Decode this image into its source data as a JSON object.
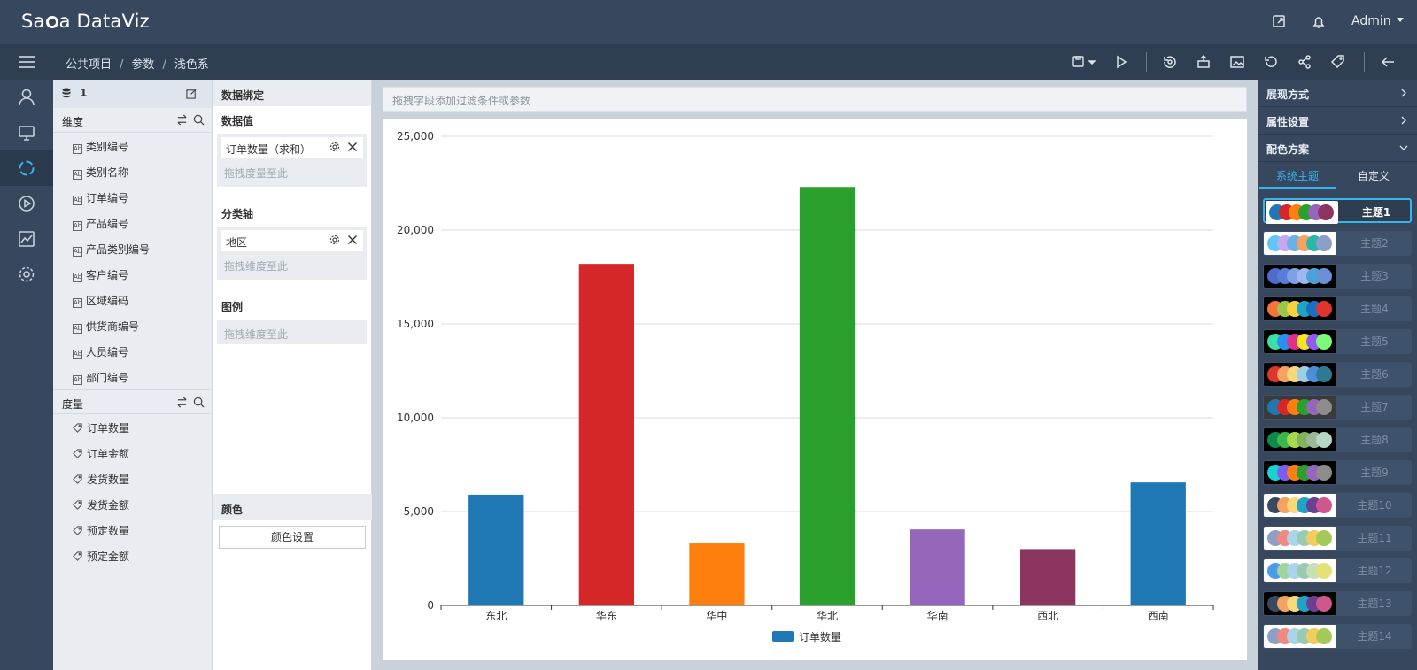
{
  "app": {
    "logo_prefix": "Sa",
    "logo_suffix": "a DataViz",
    "user": "Admin"
  },
  "breadcrumb": [
    "公共项目",
    "参数",
    "浅色系"
  ],
  "fields_panel": {
    "datasource_name": "1",
    "dimensions_title": "维度",
    "dimensions": [
      "类别编号",
      "类别名称",
      "订单编号",
      "产品编号",
      "产品类别编号",
      "客户编号",
      "区域编码",
      "供货商编号",
      "人员编号",
      "部门编号"
    ],
    "measures_title": "度量",
    "measures": [
      "订单数量",
      "订单金额",
      "发货数量",
      "发货金额",
      "预定数量",
      "预定金额"
    ]
  },
  "binding": {
    "title": "数据绑定",
    "value_label": "数据值",
    "value_chip": "订单数量（求和）",
    "value_drop": "拖拽度量至此",
    "axis_label": "分类轴",
    "axis_chip": "地区",
    "axis_drop": "拖拽维度至此",
    "legend_label": "图例",
    "legend_drop": "拖拽维度至此",
    "color_label": "颜色",
    "color_button": "颜色设置"
  },
  "filter_placeholder": "拖拽字段添加过滤条件或参数",
  "chart_data": {
    "type": "bar",
    "categories": [
      "东北",
      "华东",
      "华中",
      "华北",
      "华南",
      "西北",
      "西南"
    ],
    "series": [
      {
        "name": "订单数量",
        "values": [
          5900,
          18200,
          3300,
          22300,
          4050,
          3000,
          6550
        ]
      }
    ],
    "bar_colors": [
      "#1f77b4",
      "#d62728",
      "#ff7f0e",
      "#2ca02c",
      "#9467bd",
      "#8c3560",
      "#1f77b4"
    ],
    "ylim": [
      0,
      25000
    ],
    "yticks": [
      "0",
      "5,000",
      "10,000",
      "15,000",
      "20,000",
      "25,000"
    ],
    "grid": true,
    "legend_position": "bottom"
  },
  "right_panel": {
    "section_display": "展现方式",
    "section_props": "属性设置",
    "section_colors": "配色方案",
    "tab_system": "系统主题",
    "tab_custom": "自定义",
    "themes": [
      {
        "name": "主题1",
        "bg": "#ffffff",
        "colors": [
          "#1f77b4",
          "#d62728",
          "#ff7f0e",
          "#2ca02c",
          "#9467bd",
          "#8c3560"
        ]
      },
      {
        "name": "主题2",
        "bg": "#ffffff",
        "colors": [
          "#5bc8f5",
          "#c8a8e9",
          "#6ab0e9",
          "#f4a261",
          "#2ab7a9",
          "#8e9fc6"
        ]
      },
      {
        "name": "主题3",
        "bg": "#000000",
        "colors": [
          "#4e6bc9",
          "#5a7bd8",
          "#7f9fe6",
          "#9fb7f0",
          "#4aa3d8",
          "#6c8fd6"
        ]
      },
      {
        "name": "主题4",
        "bg": "#000000",
        "colors": [
          "#f4743b",
          "#9ac94a",
          "#f7d23e",
          "#1fa3c7",
          "#1a6fc2",
          "#e0342f"
        ]
      },
      {
        "name": "主题5",
        "bg": "#000000",
        "colors": [
          "#39e0a8",
          "#2b8ef0",
          "#e0308a",
          "#f5e526",
          "#8f5cf0",
          "#7dfa7a"
        ]
      },
      {
        "name": "主题6",
        "bg": "#000000",
        "colors": [
          "#e0342f",
          "#f4a261",
          "#f7d87a",
          "#9ccfe6",
          "#4c8fd8",
          "#2f7a90"
        ]
      },
      {
        "name": "主题7",
        "bg": "#3a3a3a",
        "colors": [
          "#1f77b4",
          "#d62728",
          "#ff7f0e",
          "#2ca02c",
          "#9467bd",
          "#8c8c8c"
        ]
      },
      {
        "name": "主题8",
        "bg": "#000000",
        "colors": [
          "#0f8a4a",
          "#3cb84f",
          "#a5d84a",
          "#7fb45a",
          "#9bb89a",
          "#b7d7c6"
        ]
      },
      {
        "name": "主题9",
        "bg": "#000000",
        "colors": [
          "#18d2d2",
          "#7d5cf0",
          "#ff7f0e",
          "#2ca02c",
          "#9467bd",
          "#8c8c8c"
        ]
      },
      {
        "name": "主题10",
        "bg": "#ffffff",
        "colors": [
          "#3a4a5e",
          "#f4a261",
          "#f7d87a",
          "#1fa3c7",
          "#6c3f94",
          "#d0578e"
        ]
      },
      {
        "name": "主题11",
        "bg": "#ffffff",
        "colors": [
          "#8e9fc6",
          "#f08a7e",
          "#a9d4ea",
          "#9ac9b4",
          "#f2cd5d",
          "#a3c95a"
        ]
      },
      {
        "name": "主题12",
        "bg": "#ffffff",
        "colors": [
          "#4c9be8",
          "#9fd49c",
          "#a9d4ea",
          "#9ac9b4",
          "#c5e0b4",
          "#e3e277"
        ]
      },
      {
        "name": "主题13",
        "bg": "#000000",
        "colors": [
          "#3a4a5e",
          "#f4a261",
          "#f7d87a",
          "#1fa3c7",
          "#6c3f94",
          "#d0578e"
        ]
      },
      {
        "name": "主题14",
        "bg": "#ffffff",
        "colors": [
          "#8e9fc6",
          "#f08a7e",
          "#a9d4ea",
          "#9ac9b4",
          "#f2cd5d",
          "#a3c95a"
        ]
      }
    ]
  }
}
